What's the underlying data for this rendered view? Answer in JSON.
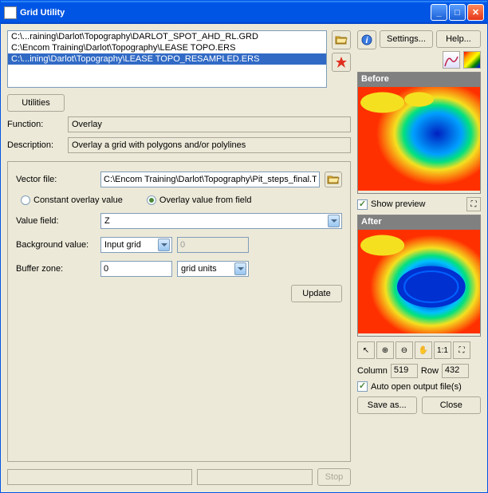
{
  "title": "Grid Utility",
  "files": [
    "C:\\...raining\\Darlot\\Topography\\DARLOT_SPOT_AHD_RL.GRD",
    "C:\\Encom Training\\Darlot\\Topography\\LEASE TOPO.ERS",
    "C:\\...ining\\Darlot\\Topography\\LEASE TOPO_RESAMPLED.ERS"
  ],
  "selected_file_index": 2,
  "buttons": {
    "settings": "Settings...",
    "help": "Help...",
    "utilities": "Utilities",
    "update": "Update",
    "stop": "Stop",
    "save_as": "Save as...",
    "close": "Close"
  },
  "labels": {
    "function": "Function:",
    "description": "Description:",
    "vector_file": "Vector file:",
    "value_field": "Value field:",
    "background_value": "Background value:",
    "buffer_zone": "Buffer zone:",
    "before": "Before",
    "after": "After",
    "show_preview": "Show preview",
    "auto_open": "Auto open output file(s)",
    "column": "Column",
    "row": "Row"
  },
  "values": {
    "function": "Overlay",
    "description": "Overlay a grid with polygons and/or polylines",
    "vector_file": "C:\\Encom Training\\Darlot\\Topography\\Pit_steps_final.TAB",
    "value_field": "Z",
    "background_value": "Input grid",
    "bg_number": "0",
    "buffer_zone": "0",
    "buffer_units": "grid units",
    "column": "519",
    "row": "432"
  },
  "radio": {
    "constant": "Constant overlay value",
    "from_field": "Overlay value from field",
    "selected": "from_field"
  },
  "checkboxes": {
    "show_preview": true,
    "auto_open": true
  },
  "zoom_labels": [
    "↖",
    "⊕",
    "⊖",
    "✋",
    "1:1",
    "⛶"
  ]
}
